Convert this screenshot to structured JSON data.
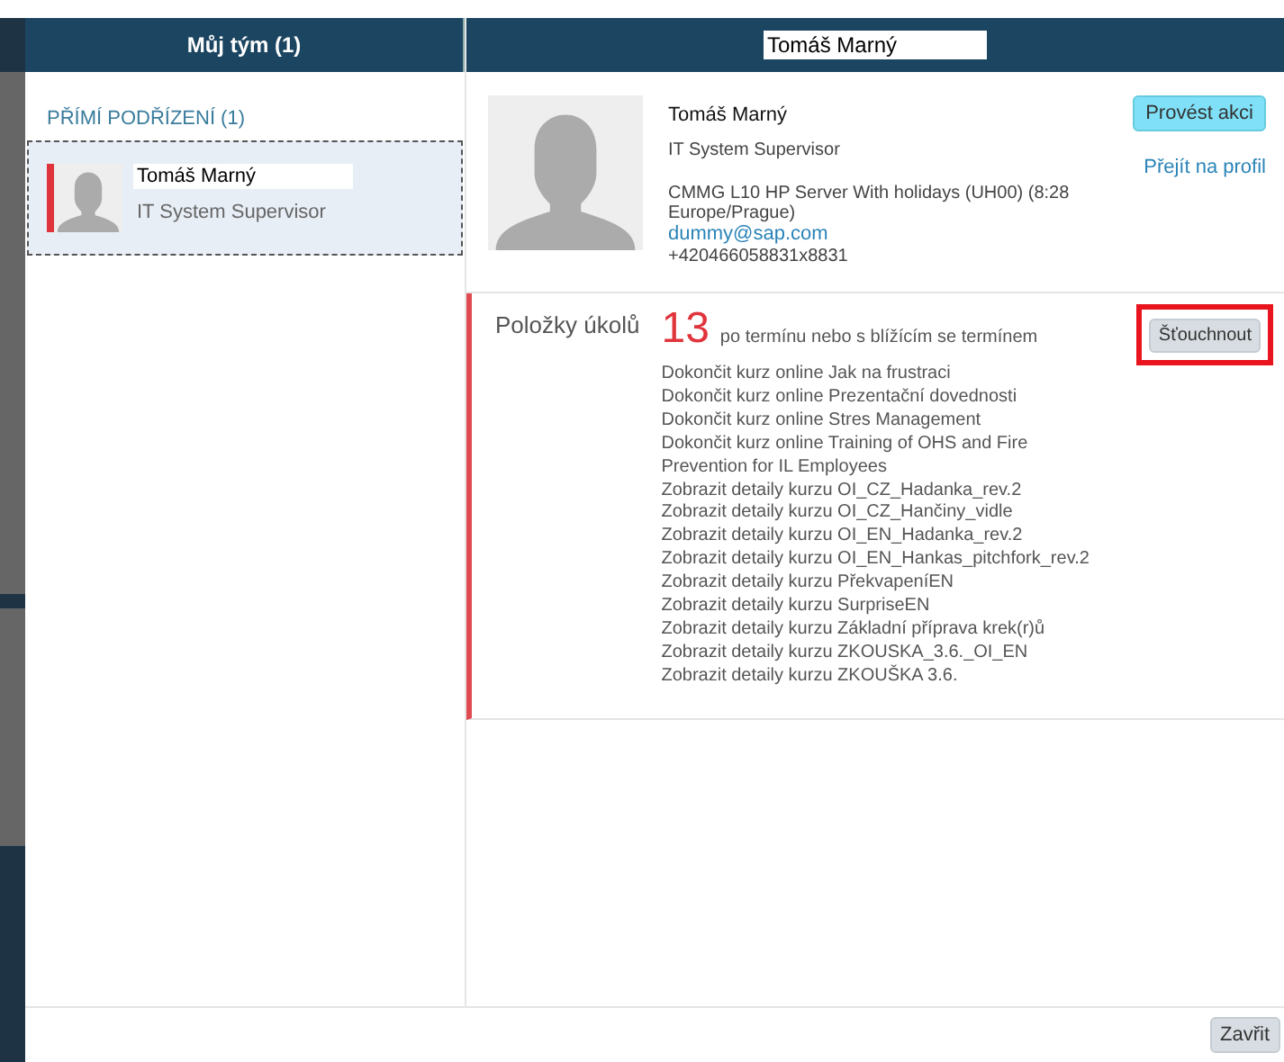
{
  "left_panel": {
    "title": "Můj tým (1)",
    "section": "PŘÍMÍ PODŘÍZENÍ (1)",
    "members": [
      {
        "name": "Tomáš Marný",
        "role": "IT System Supervisor",
        "selected": true,
        "alert": true
      }
    ]
  },
  "detail": {
    "title": "Tomáš Marný",
    "profile": {
      "name": "Tomáš Marný",
      "role": "IT System Supervisor",
      "location": "CMMG L10 HP Server With holidays (UH00) (8:28 Europe/Prague)",
      "email": "dummy@sap.com",
      "phone": "+420466058831x8831",
      "action_button": "Provést akci",
      "profile_link": "Přejít na profil"
    },
    "tasks": {
      "label": "Položky úkolů",
      "count": "13",
      "count_label": "po termínu nebo s blížícím se termínem",
      "nudge_button": "Šťouchnout",
      "nudge_highlighted": true,
      "items": [
        "Dokončit kurz online Jak na frustraci",
        "Dokončit kurz online Prezentační dovednosti",
        "Dokončit kurz online Stres Management",
        "Dokončit kurz online Training of OHS and Fire Prevention for IL Employees",
        "Zobrazit detaily kurzu OI_CZ_Hadanka_rev.2",
        "Zobrazit detaily kurzu OI_CZ_Hančiny_vidle",
        "Zobrazit detaily kurzu OI_EN_Hadanka_rev.2",
        "Zobrazit detaily kurzu OI_EN_Hankas_pitchfork_rev.2",
        "Zobrazit detaily kurzu PřekvapeníEN",
        "Zobrazit detaily kurzu SurpriseEN",
        "Zobrazit detaily kurzu Základní příprava krek(r)ů",
        "Zobrazit detaily kurzu ZKOUSKA_3.6._OI_EN",
        "Zobrazit detaily kurzu ZKOUŠKA 3.6."
      ]
    }
  },
  "footer": {
    "close_button": "Zavřit"
  }
}
